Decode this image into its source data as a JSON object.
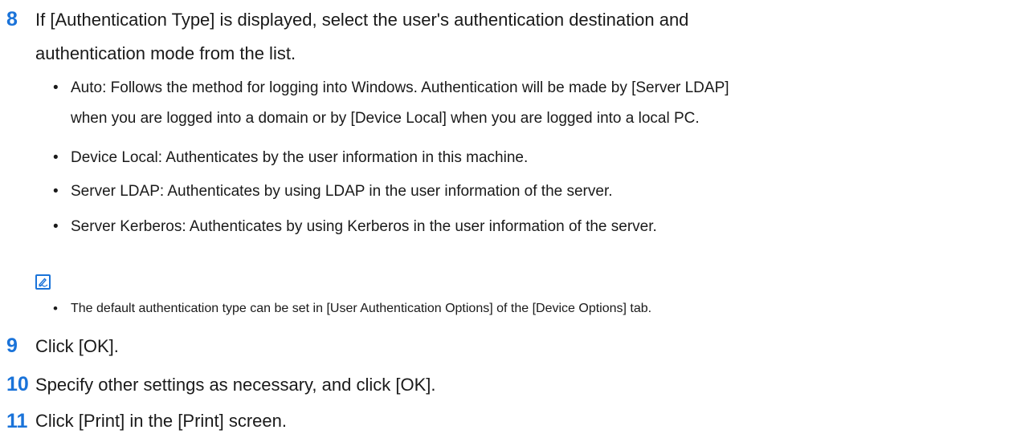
{
  "step8": {
    "number": "8",
    "line1": "If [Authentication Type] is displayed, select the user's authentication destination and",
    "line2": "authentication mode from the list."
  },
  "bullets": [
    {
      "line1": "Auto: Follows the method for logging into Windows. Authentication will be made by [Server LDAP]",
      "line2": "when you are logged into a domain or by [Device Local] when you are logged into a local PC."
    },
    {
      "line1": "Device Local: Authenticates by the user information in this machine."
    },
    {
      "line1": "Server LDAP: Authenticates by using LDAP in the user information of the server."
    },
    {
      "line1": "Server Kerberos: Authenticates by using Kerberos in the user information of the server."
    }
  ],
  "note": {
    "icon": "memo-pen-icon",
    "text": "The default authentication type can be set in [User Authentication Options] of the [Device Options] tab."
  },
  "step9": {
    "number": "9",
    "text": "Click [OK]."
  },
  "step10": {
    "number": "10",
    "text": "Specify other settings as necessary, and click [OK]."
  },
  "step11": {
    "number": "11",
    "text": "Click [Print] in the [Print] screen."
  },
  "colors": {
    "accent": "#1a73d9",
    "text": "#1a1a1a"
  }
}
